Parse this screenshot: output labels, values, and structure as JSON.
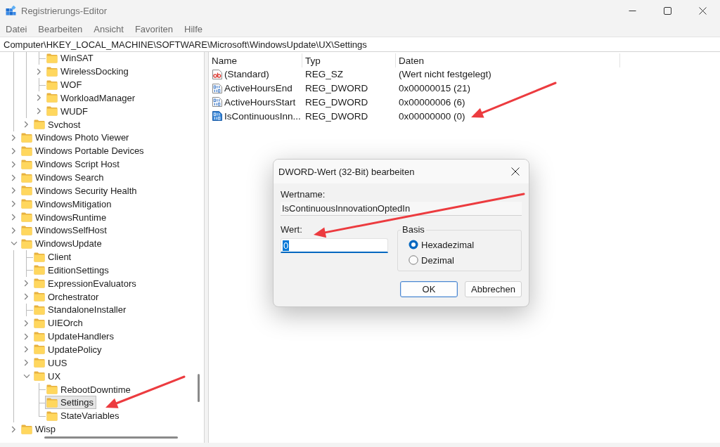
{
  "window": {
    "title": "Registrierungs-Editor"
  },
  "menu": [
    "Datei",
    "Bearbeiten",
    "Ansicht",
    "Favoriten",
    "Hilfe"
  ],
  "address_bar": {
    "value": "Computer\\HKEY_LOCAL_MACHINE\\SOFTWARE\\Microsoft\\WindowsUpdate\\UX\\Settings"
  },
  "tree": {
    "nodes": [
      {
        "children": [
          {
            "children": [
              {
                "label": "WinSAT",
                "kind": "leaf",
                "selected": false
              },
              {
                "label": "WirelessDocking",
                "kind": "branch",
                "expanded": false,
                "selected": false
              },
              {
                "label": "WOF",
                "kind": "leaf",
                "selected": false
              },
              {
                "label": "WorkloadManager",
                "kind": "branch",
                "expanded": false,
                "selected": false
              },
              {
                "label": "WUDF",
                "kind": "branch",
                "expanded": false,
                "selected": false
              }
            ]
          },
          {
            "label": "Svchost",
            "kind": "branch",
            "expanded": false,
            "selected": false
          }
        ]
      },
      {
        "label": "Windows Photo Viewer",
        "kind": "branch",
        "expanded": false,
        "selected": false
      },
      {
        "label": "Windows Portable Devices",
        "kind": "branch",
        "expanded": false,
        "selected": false
      },
      {
        "label": "Windows Script Host",
        "kind": "branch",
        "expanded": false,
        "selected": false
      },
      {
        "label": "Windows Search",
        "kind": "branch",
        "expanded": false,
        "selected": false
      },
      {
        "label": "Windows Security Health",
        "kind": "branch",
        "expanded": false,
        "selected": false
      },
      {
        "label": "WindowsMitigation",
        "kind": "branch",
        "expanded": false,
        "selected": false
      },
      {
        "label": "WindowsRuntime",
        "kind": "branch",
        "expanded": false,
        "selected": false
      },
      {
        "label": "WindowsSelfHost",
        "kind": "branch",
        "expanded": false,
        "selected": false
      },
      {
        "label": "WindowsUpdate",
        "kind": "branch",
        "expanded": true,
        "selected": false,
        "children": [
          {
            "label": "Client",
            "kind": "leaf",
            "selected": false
          },
          {
            "label": "EditionSettings",
            "kind": "leaf",
            "selected": false
          },
          {
            "label": "ExpressionEvaluators",
            "kind": "branch",
            "expanded": false,
            "selected": false
          },
          {
            "label": "Orchestrator",
            "kind": "branch",
            "expanded": false,
            "selected": false
          },
          {
            "label": "StandaloneInstaller",
            "kind": "leaf",
            "selected": false
          },
          {
            "label": "UIEOrch",
            "kind": "branch",
            "expanded": false,
            "selected": false
          },
          {
            "label": "UpdateHandlers",
            "kind": "branch",
            "expanded": false,
            "selected": false
          },
          {
            "label": "UpdatePolicy",
            "kind": "branch",
            "expanded": false,
            "selected": false
          },
          {
            "label": "UUS",
            "kind": "branch",
            "expanded": false,
            "selected": false
          },
          {
            "label": "UX",
            "kind": "branch",
            "expanded": true,
            "selected": false,
            "children": [
              {
                "label": "RebootDowntime",
                "kind": "leaf",
                "selected": false
              },
              {
                "label": "Settings",
                "kind": "leaf",
                "selected": true
              },
              {
                "label": "StateVariables",
                "kind": "leaf",
                "selected": false
              }
            ]
          }
        ]
      },
      {
        "label": "Wisp",
        "kind": "branch",
        "expanded": false,
        "selected": false
      }
    ]
  },
  "values": {
    "columns": [
      "Name",
      "Typ",
      "Daten"
    ],
    "rows": [
      {
        "kind": "string",
        "name": "(Standard)",
        "type": "REG_SZ",
        "data": "(Wert nicht festgelegt)",
        "selected": false
      },
      {
        "kind": "dword",
        "name": "ActiveHoursEnd",
        "type": "REG_DWORD",
        "data": "0x00000015 (21)",
        "selected": false
      },
      {
        "kind": "dword",
        "name": "ActiveHoursStart",
        "type": "REG_DWORD",
        "data": "0x00000006 (6)",
        "selected": false
      },
      {
        "kind": "dword",
        "name": "IsContinuousInn...",
        "type": "REG_DWORD",
        "data": "0x00000000 (0)",
        "selected": true
      }
    ]
  },
  "dialog": {
    "title": "DWORD-Wert (32-Bit) bearbeiten",
    "value_name": {
      "label": "Wertname:",
      "value": "IsContinuousInnovationOptedIn"
    },
    "value_data": {
      "label": "Wert:",
      "value": "0",
      "text_selected": true
    },
    "base": {
      "label": "Basis",
      "options": [
        {
          "label": "Hexadezimal",
          "selected": true
        },
        {
          "label": "Dezimal",
          "selected": false
        }
      ]
    },
    "buttons": [
      {
        "label": "OK",
        "default": true
      },
      {
        "label": "Abbrechen",
        "default": false
      }
    ]
  }
}
